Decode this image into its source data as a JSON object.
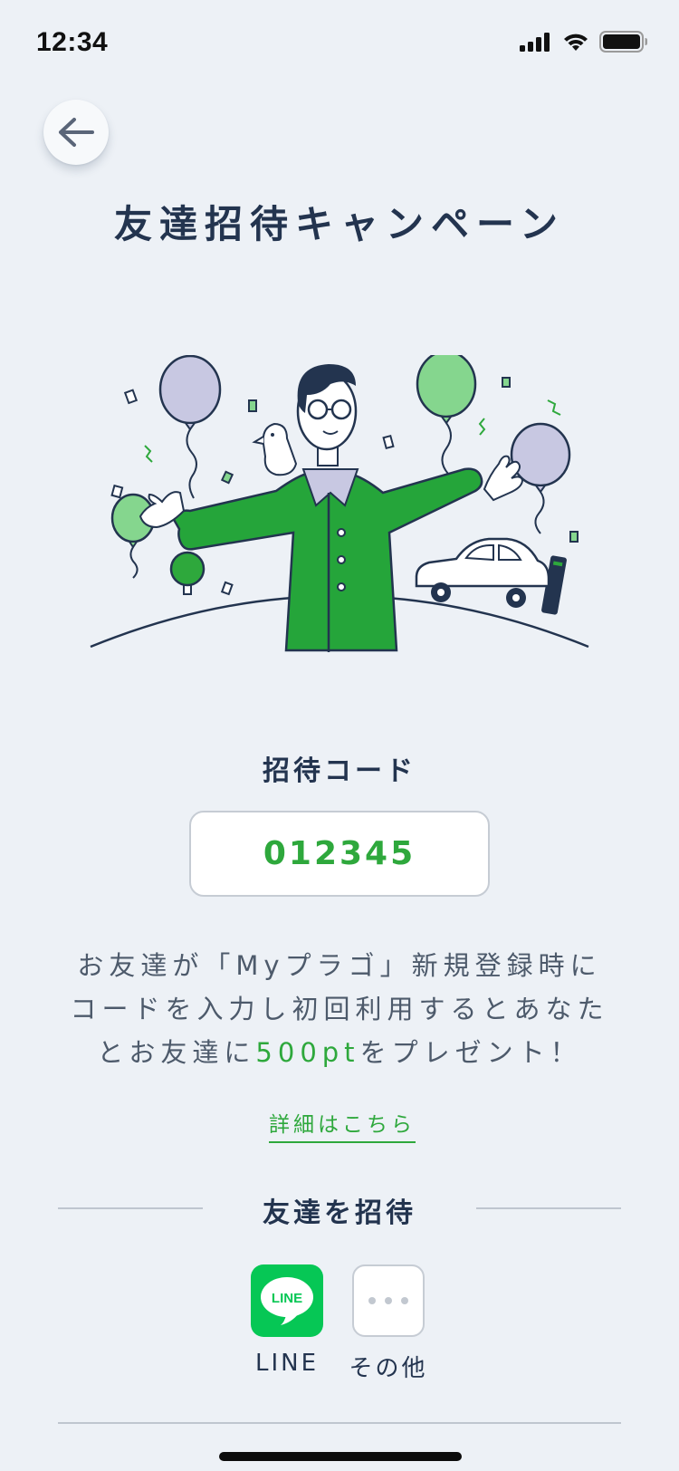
{
  "status_bar": {
    "time": "12:34"
  },
  "header": {
    "title": "友達招待キャンペーン"
  },
  "invite": {
    "code_label": "招待コード",
    "code": "012345",
    "description_line1": "お友達が「Myプラゴ」新規登録時に",
    "description_line2": "コードを入力し初回利用するとあなた",
    "description_line3_pre": "とお友達に",
    "description_points": "500pt",
    "description_line3_post": "をプレゼント！",
    "details_link": "詳細はこちら"
  },
  "share": {
    "heading": "友達を招待",
    "line_icon_text": "LINE",
    "line_label": "LINE",
    "more_label": "その他"
  },
  "colors": {
    "background": "#edf1f6",
    "accent_green": "#2ea83c",
    "line_green": "#06c755",
    "text_dark": "#23344f"
  }
}
